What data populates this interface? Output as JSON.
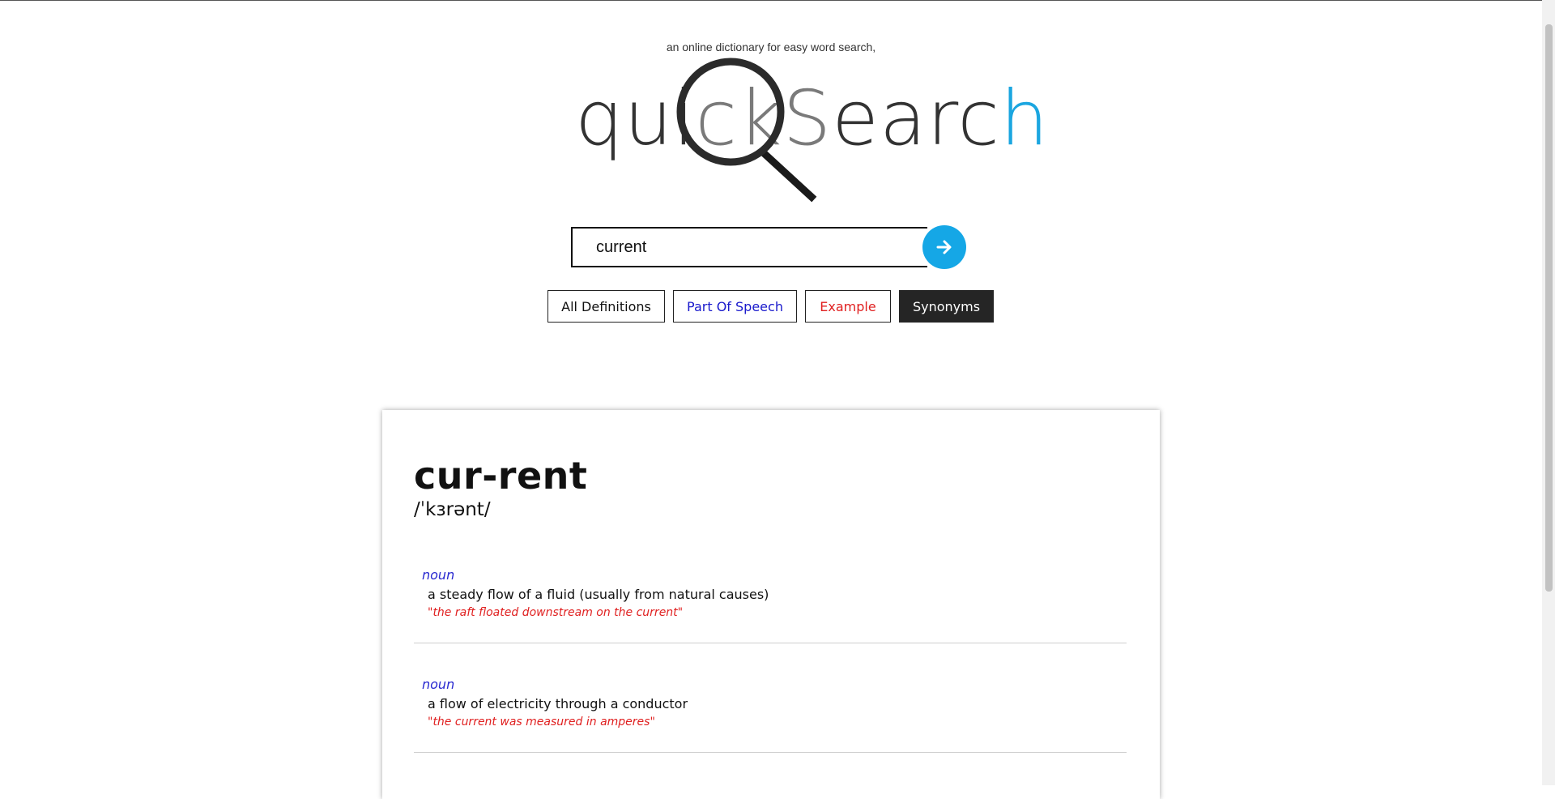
{
  "header": {
    "tagline": "an online dictionary for easy word search,",
    "logo": {
      "part1": "qui",
      "part2": "ckS",
      "part3": "earc",
      "part4": "h"
    }
  },
  "search": {
    "value": "current",
    "button_icon": "arrow-right-icon"
  },
  "filters": [
    {
      "label": "All Definitions",
      "color": "#111111"
    },
    {
      "label": "Part Of Speech",
      "color": "#1a1acc"
    },
    {
      "label": "Example",
      "color": "#e02020"
    },
    {
      "label": "Synonyms",
      "color": "#ffffff",
      "active": true
    }
  ],
  "result": {
    "headword": "cur-rent",
    "pronunciation": "/ˈkɜrənt/",
    "entries": [
      {
        "pos": "noun",
        "definition": "a steady flow of a fluid (usually from natural causes)",
        "example": "\"the raft floated downstream on the current\""
      },
      {
        "pos": "noun",
        "definition": "a flow of electricity through a conductor",
        "example": "\"the current was measured in amperes\""
      }
    ]
  },
  "colors": {
    "accent_blue": "#15a7e6",
    "pos_color": "#2a2ad0",
    "example_color": "#e02020"
  }
}
